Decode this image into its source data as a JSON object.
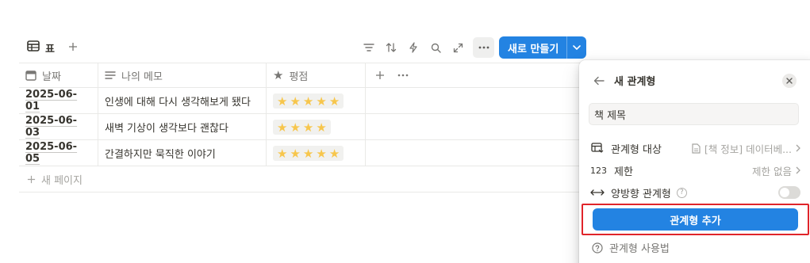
{
  "view": {
    "tab_label": "표"
  },
  "toolbar": {
    "new_label": "새로 만들기"
  },
  "table": {
    "columns": [
      "날짜",
      "나의 메모",
      "평점"
    ],
    "rows": [
      {
        "date": "2025-06-01",
        "memo": "인생에 대해 다시 생각해보게 됐다",
        "rating": 5
      },
      {
        "date": "2025-06-03",
        "memo": "새벽 기상이 생각보다 괜찮다",
        "rating": 4
      },
      {
        "date": "2025-06-05",
        "memo": "간결하지만 묵직한 이야기",
        "rating": 5
      }
    ],
    "new_page_label": "새 페이지"
  },
  "panel": {
    "title": "새 관계형",
    "name_value": "책 제목",
    "relation_target_label": "관계형 대상",
    "relation_target_value": "[책 정보] 데이터베...",
    "limit_icon_text": "123",
    "limit_label": "제한",
    "limit_value": "제한 없음",
    "bidirectional_label": "양방향 관계형",
    "add_button_label": "관계형 추가",
    "help_label": "관계형 사용법"
  },
  "colors": {
    "accent": "#2383e2",
    "star": "#f7c64c",
    "highlight": "#e0242a"
  }
}
